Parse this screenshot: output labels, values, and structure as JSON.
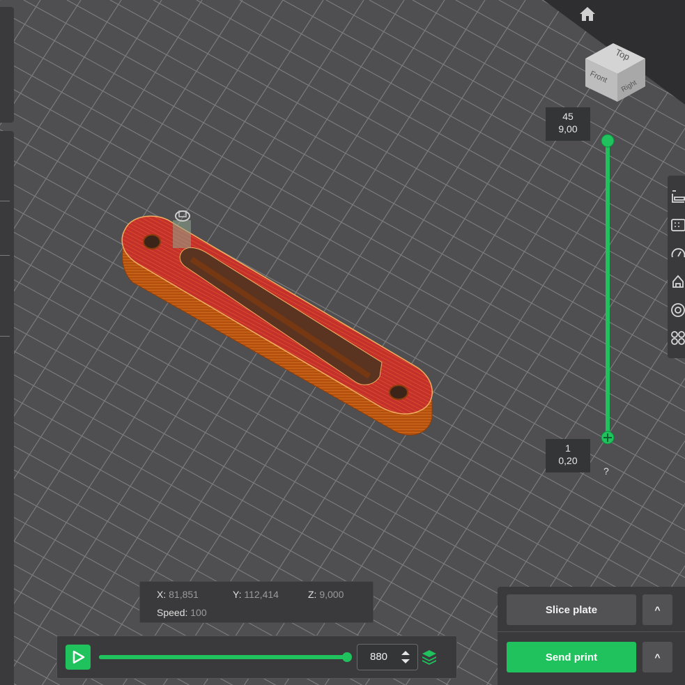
{
  "layer_slider": {
    "top_layer": "45",
    "top_height": "9,00",
    "bottom_layer": "1",
    "bottom_height": "0,20",
    "help": "?",
    "accent": "#1fc25d"
  },
  "view_cube": {
    "top": "Top",
    "front": "Front",
    "right": "Right",
    "home_icon": "home-icon"
  },
  "position_readout": {
    "x_label": "X:",
    "x_value": "81,851",
    "y_label": "Y:",
    "y_value": "112,414",
    "z_label": "Z:",
    "z_value": "9,000",
    "speed_label": "Speed:",
    "speed_value": "100"
  },
  "playback": {
    "play_icon": "play-icon",
    "progress": 1.0,
    "move_value": "880",
    "layers_icon": "layers-icon"
  },
  "actions": {
    "slice_label": "Slice plate",
    "slice_more": "^",
    "send_label": "Send print",
    "send_more": "^"
  },
  "right_toolbar": {
    "icons": [
      "layers-legend-icon",
      "grid-view-icon",
      "speed-gauge-icon",
      "support-icon",
      "target-icon",
      "arrange-icon"
    ]
  },
  "colors": {
    "bed": "#4f4f51",
    "model_top": "#c8332a",
    "model_wall": "#b5520f"
  }
}
